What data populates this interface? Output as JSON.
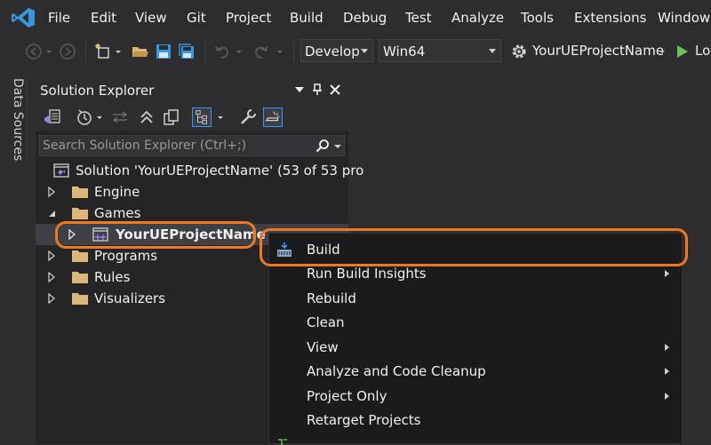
{
  "menubar": {
    "items": [
      "File",
      "Edit",
      "View",
      "Git",
      "Project",
      "Build",
      "Debug",
      "Test",
      "Analyze",
      "Tools",
      "Extensions",
      "Window"
    ]
  },
  "toolbar": {
    "config_value": "Develop",
    "platform_value": "Win64",
    "startup_project": "YourUEProjectName",
    "run_label": "Lo"
  },
  "side_tab": {
    "label": "Data Sources"
  },
  "solution_explorer": {
    "title": "Solution Explorer",
    "search_placeholder": "Search Solution Explorer (Ctrl+;)",
    "tree": {
      "solution": "Solution 'YourUEProjectName'   (53 of 53 pro",
      "engine": "Engine",
      "games": "Games",
      "project": "YourUEProjectName",
      "programs": "Programs",
      "rules": "Rules",
      "visualizers": "Visualizers"
    }
  },
  "context_menu": {
    "items": [
      {
        "label": "Build"
      },
      {
        "label": "Run Build Insights"
      },
      {
        "label": "Rebuild"
      },
      {
        "label": "Clean"
      },
      {
        "label": "View"
      },
      {
        "label": "Analyze and Code Cleanup"
      },
      {
        "label": "Project Only"
      },
      {
        "label": "Retarget Projects"
      }
    ]
  },
  "colors": {
    "highlight_ring": "#f07820",
    "background": "#2d2d30",
    "panel": "#252526",
    "menu": "#1b1b1c",
    "vs_purple": "#9b7fe6",
    "folder": "#dcb67a",
    "accent_blue": "#3399ff",
    "run_green": "#6ac259"
  }
}
